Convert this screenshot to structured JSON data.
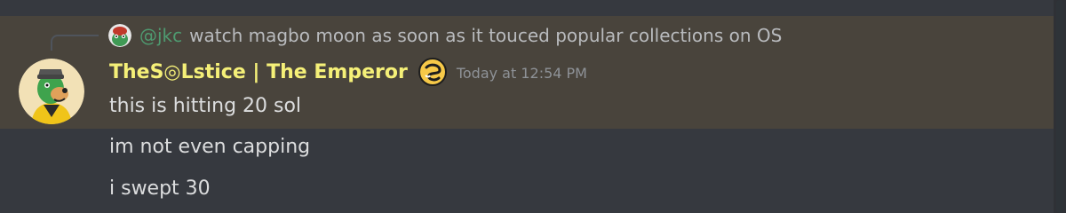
{
  "reply": {
    "author": "@jkc",
    "text": "watch magbo moon as soon as it touced popular collections on OS"
  },
  "message": {
    "username": "TheS◎Lstice | The Emperor",
    "timestamp": "Today at 12:54 PM",
    "lines": [
      "this is hitting 20 sol",
      "im not even capping",
      "i swept 30"
    ]
  },
  "colors": {
    "background": "#36393f",
    "highlight": "#49443c",
    "username": "#f5f078",
    "reply_author": "#4e9a70",
    "timestamp": "#8e9297",
    "text": "#dcddde"
  },
  "icons": {
    "reply_avatar": "frog-avatar-icon",
    "avatar": "dog-avatar-icon",
    "role_badge": "swirl-badge-icon"
  }
}
